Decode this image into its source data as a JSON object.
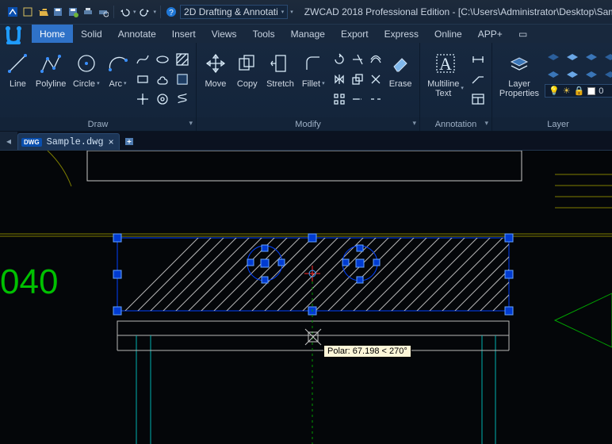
{
  "qat": {
    "dropdown_label": "2D Drafting & Annotati"
  },
  "title": "ZWCAD 2018 Professional Edition - [C:\\Users\\Administrator\\Desktop\\Samp",
  "tabs": [
    "Home",
    "Solid",
    "Annotate",
    "Insert",
    "Views",
    "Tools",
    "Manage",
    "Export",
    "Express",
    "Online",
    "APP+"
  ],
  "active_tab_index": 0,
  "panels": {
    "draw": {
      "title": "Draw",
      "line": "Line",
      "polyline": "Polyline",
      "circle": "Circle",
      "arc": "Arc"
    },
    "modify": {
      "title": "Modify",
      "move": "Move",
      "copy": "Copy",
      "stretch": "Stretch",
      "fillet": "Fillet",
      "erase": "Erase"
    },
    "annotation": {
      "title": "Annotation",
      "multiline_text": "Multiline\nText"
    },
    "layer": {
      "title": "Layer",
      "layer_properties": "Layer\nProperties",
      "current_layer": "0"
    }
  },
  "doc_tab": {
    "badge": "DWG",
    "filename": "Sample.dwg"
  },
  "drawing": {
    "dim_text": "040"
  },
  "tooltip": "Polar: 67.198 < 270°"
}
